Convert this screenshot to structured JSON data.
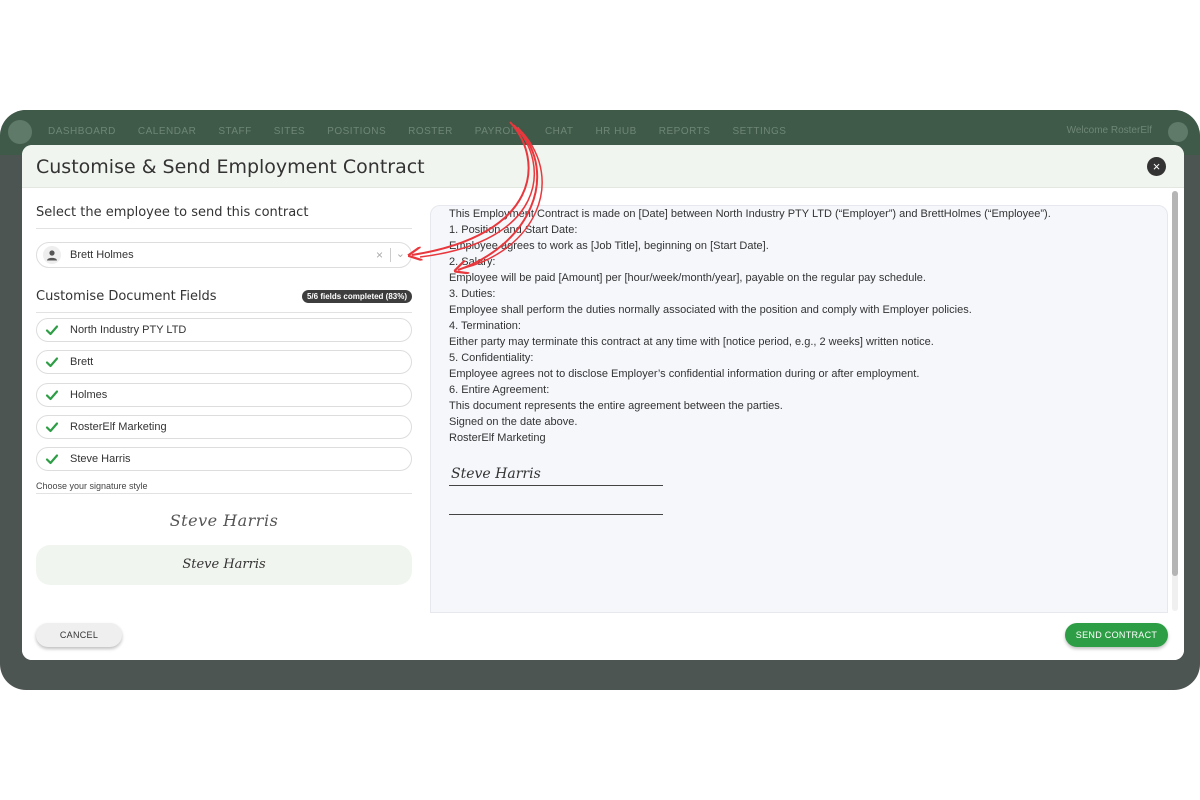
{
  "nav": {
    "items": [
      "DASHBOARD",
      "CALENDAR",
      "STAFF",
      "SITES",
      "POSITIONS",
      "ROSTER",
      "PAYROLL",
      "CHAT",
      "HR HUB",
      "REPORTS",
      "SETTINGS"
    ],
    "welcome": "Welcome RosterElf"
  },
  "modal": {
    "title": "Customise & Send Employment Contract",
    "close_icon": "×"
  },
  "employee_select": {
    "label": "Select the employee to send this contract",
    "value": "Brett Holmes",
    "clear": "×",
    "chevron": "⌄"
  },
  "fields_section": {
    "label": "Customise Document Fields",
    "progress": "5/6 fields completed (83%)",
    "progress_fraction": 0.83,
    "fields": [
      "North Industry PTY LTD",
      "Brett",
      "Holmes",
      "RosterElf Marketing",
      "Steve Harris"
    ]
  },
  "signature": {
    "label": "Choose your signature style",
    "option_1": "Steve Harris",
    "option_2": "Steve Harris"
  },
  "document": {
    "lines": [
      "This Employment Contract is made on [Date] between North Industry PTY LTD (“Employer”) and BrettHolmes (“Employee”).",
      "1. Position and Start Date:",
      "Employee agrees to work as [Job Title], beginning on [Start Date].",
      "2. Salary:",
      "Employee will be paid [Amount] per [hour/week/month/year], payable on the regular pay schedule.",
      "3. Duties:",
      "Employee shall perform the duties normally associated with the position and comply with Employer policies.",
      "4. Termination:",
      "Either party may terminate this contract at any time with [notice period, e.g., 2 weeks] written notice.",
      "5. Confidentiality:",
      "Employee agrees not to disclose Employer’s confidential information during or after employment.",
      "6. Entire Agreement:",
      "This document represents the entire agreement between the parties.",
      "Signed on the date above.",
      "RosterElf Marketing"
    ],
    "signature": "Steve Harris"
  },
  "footer": {
    "cancel_label": "CANCEL",
    "send_label": "SEND CONTRACT"
  },
  "colors": {
    "accent_green": "#2e9e46",
    "annotation_red": "#e8383d",
    "header_bg": "#f1f5ef"
  }
}
